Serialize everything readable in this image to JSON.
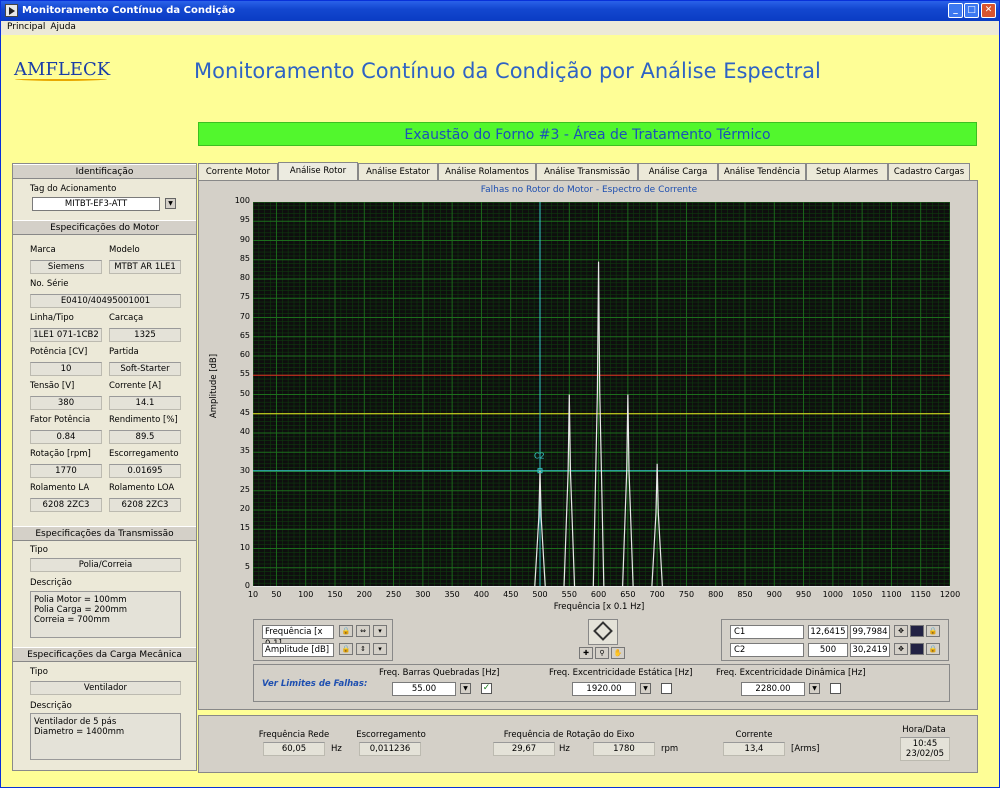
{
  "window": {
    "title": "Monitoramento Contínuo da Condição",
    "buttons": [
      "_",
      "□",
      "✕"
    ]
  },
  "menu": [
    "Principal",
    "Ajuda"
  ],
  "brand": "AMFLECK",
  "main_title": "Monitoramento Contínuo da Condição por Análise Espectral",
  "banner": "Exaustão do Forno #3 - Área de Tratamento Térmico",
  "left": {
    "ident_header": "Identificação",
    "tag_label": "Tag do Acionamento",
    "tag_value": "MITBT-EF3-ATT",
    "motor_header": "Especificações do Motor",
    "marca_label": "Marca",
    "marca": "Siemens",
    "modelo_label": "Modelo",
    "modelo": "MTBT AR 1LE1",
    "serie_label": "No. Série",
    "serie": "E0410/40495001001",
    "linha_label": "Linha/Tipo",
    "linha": "1LE1 071-1CB2",
    "carcaca_label": "Carcaça",
    "carcaca": "1325",
    "potencia_label": "Potência [CV]",
    "potencia": "10",
    "partida_label": "Partida",
    "partida": "Soft-Starter",
    "tensao_label": "Tensão [V]",
    "tensao": "380",
    "corrente_label": "Corrente [A]",
    "corrente": "14.1",
    "fp_label": "Fator Potência",
    "fp": "0.84",
    "rend_label": "Rendimento [%]",
    "rend": "89.5",
    "rot_label": "Rotação [rpm]",
    "rot": "1770",
    "esc_label": "Escorregamento",
    "esc": "0.01695",
    "rla_label": "Rolamento LA",
    "rla": "6208 2ZC3",
    "rloa_label": "Rolamento LOA",
    "rloa": "6208 2ZC3",
    "trans_header": "Especificações da Transmissão",
    "trans_tipo_label": "Tipo",
    "trans_tipo": "Polia/Correia",
    "trans_desc_label": "Descrição",
    "trans_desc": [
      "Polia Motor = 100mm",
      "Polia Carga = 200mm",
      "Correia = 700mm"
    ],
    "carga_header": "Especificações da Carga Mecânica",
    "carga_tipo_label": "Tipo",
    "carga_tipo": "Ventilador",
    "carga_desc_label": "Descrição",
    "carga_desc": [
      "Ventilador de 5 pás",
      "Diametro = 1400mm"
    ]
  },
  "tabs": [
    "Corrente Motor",
    "Análise Rotor",
    "Análise Estator",
    "Análise Rolamentos",
    "Análise Transmissão",
    "Análise Carga",
    "Análise Tendência",
    "Setup Alarmes",
    "Cadastro Cargas"
  ],
  "active_tab": 1,
  "chart_data": {
    "type": "line",
    "title": "Falhas no Rotor do Motor - Espectro de Corrente",
    "xlabel": "Frequência [x 0.1 Hz]",
    "ylabel": "Amplitude [dB]",
    "xlim": [
      10,
      1200
    ],
    "ylim": [
      0,
      100
    ],
    "xticks": [
      10,
      50,
      100,
      150,
      200,
      250,
      300,
      350,
      400,
      450,
      500,
      550,
      600,
      650,
      700,
      750,
      800,
      850,
      900,
      950,
      1000,
      1050,
      1100,
      1150,
      1200
    ],
    "yticks": [
      0,
      5,
      10,
      15,
      20,
      25,
      30,
      35,
      40,
      45,
      50,
      55,
      60,
      65,
      70,
      75,
      80,
      85,
      90,
      95,
      100
    ],
    "peaks": [
      {
        "x": 500,
        "y": 30.2
      },
      {
        "x": 550,
        "y": 50
      },
      {
        "x": 600,
        "y": 84.5
      },
      {
        "x": 650,
        "y": 50
      },
      {
        "x": 700,
        "y": 32
      }
    ],
    "limit_lines": [
      {
        "y": 55,
        "color": "#e0241e"
      },
      {
        "y": 45,
        "color": "#e6e41e"
      },
      {
        "y": 30.2,
        "color": "#35c8c8"
      }
    ],
    "cursor": {
      "name": "C2",
      "x": 500,
      "y": 30.2,
      "color": "#35c8c8"
    },
    "colors": {
      "background": "#0e0e0e",
      "grid": "#1c6e1c",
      "trace": "#e8e8e8"
    }
  },
  "scale": {
    "x_label": "Frequência [x 0.1]",
    "y_label": "Amplitude [dB]"
  },
  "cursors": [
    {
      "name": "C1",
      "x": "12,6415",
      "y": "99,7984"
    },
    {
      "name": "C2",
      "x": "500",
      "y": "30,2419"
    }
  ],
  "limits": {
    "title": "Ver Limites de Falhas:",
    "items": [
      {
        "label": "Freq. Barras Quebradas [Hz]",
        "value": "55.00",
        "checked": true
      },
      {
        "label": "Freq. Excentricidade Estática [Hz]",
        "value": "1920.00",
        "checked": false
      },
      {
        "label": "Freq. Excentricidade Dinâmica [Hz]",
        "value": "2280.00",
        "checked": false
      }
    ]
  },
  "bottom": {
    "freq_rede_label": "Frequência Rede",
    "freq_rede": "60,05",
    "freq_rede_unit": "Hz",
    "esc_label": "Escorregamento",
    "esc": "0,011236",
    "rot_label": "Frequência de Rotação do Eixo",
    "rot_hz": "29,67",
    "rot_hz_unit": "Hz",
    "rot_rpm": "1780",
    "rot_rpm_unit": "rpm",
    "corr_label": "Corrente",
    "corr": "13,4",
    "corr_unit": "[Arms]",
    "hora_label": "Hora/Data",
    "hora": "10:45",
    "data": "23/02/05"
  }
}
